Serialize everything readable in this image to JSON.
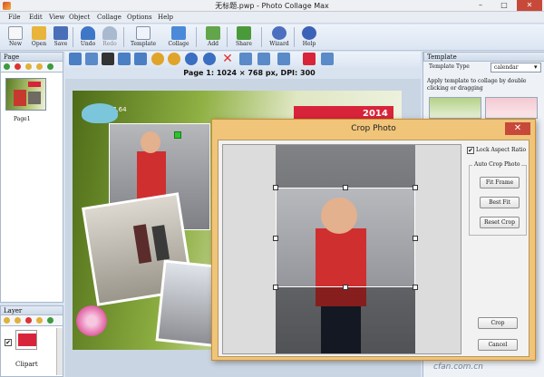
{
  "window": {
    "title": "无标题.pwp - Photo Collage Max",
    "minimize": "–",
    "maximize": "□",
    "close": "✕"
  },
  "menu": [
    "File",
    "Edit",
    "View",
    "Object",
    "Collage",
    "Options",
    "Help"
  ],
  "toolbar": {
    "buttons": [
      {
        "label": "New",
        "icon": "new-icon",
        "color": "#f4f4f4"
      },
      {
        "label": "Open",
        "icon": "open-folder-icon",
        "color": "#e8b43c"
      },
      {
        "label": "Save",
        "icon": "save-icon",
        "color": "#4a6fb8"
      },
      {
        "label": "Undo",
        "icon": "undo-icon",
        "color": "#3f77c8"
      },
      {
        "label": "Redo",
        "icon": "redo-icon",
        "color": "#9fb3cc"
      },
      {
        "label": "Template",
        "icon": "template-icon",
        "color": "#e6eef8"
      },
      {
        "label": "Collage",
        "icon": "collage-icon",
        "color": "#4a8ad8"
      },
      {
        "label": "Add",
        "icon": "add-icon",
        "color": "#62a54a"
      },
      {
        "label": "Share",
        "icon": "share-icon",
        "color": "#4b9a3a"
      },
      {
        "label": "Wizard",
        "icon": "wizard-icon",
        "color": "#4d6fc0"
      },
      {
        "label": "Help",
        "icon": "help-icon",
        "color": "#3a63b8"
      }
    ]
  },
  "left_panel": {
    "page_title": "Page",
    "page_label": "Page1",
    "layer_title": "Layer",
    "layer_label": "Clipart"
  },
  "canvas_info": {
    "page_info": "Page 1: 1024 × 768 px, DPI: 300",
    "year_badge": "2014",
    "small_text": "7.64"
  },
  "right_panel": {
    "title": "Template",
    "type_label": "Template Type",
    "type_value": "calendar",
    "hint": "Apply template to collage by double clicking or dragging"
  },
  "dialog": {
    "title": "Crop Photo",
    "close": "✕",
    "lock_label": "Lock Aspect Ratio",
    "auto_crop_title": "Auto Crop Photo",
    "fit_frame": "Fit Frame",
    "best_fit": "Best Fit",
    "reset_crop": "Reset Crop",
    "crop": "Crop",
    "cancel": "Cancel"
  },
  "watermark": "cfan.com.cn",
  "colors": {
    "accent_blue": "#3a6fc2",
    "dialog_frame": "#f0c479",
    "close_red": "#c7493a",
    "year_badge_red": "#d8243a"
  }
}
